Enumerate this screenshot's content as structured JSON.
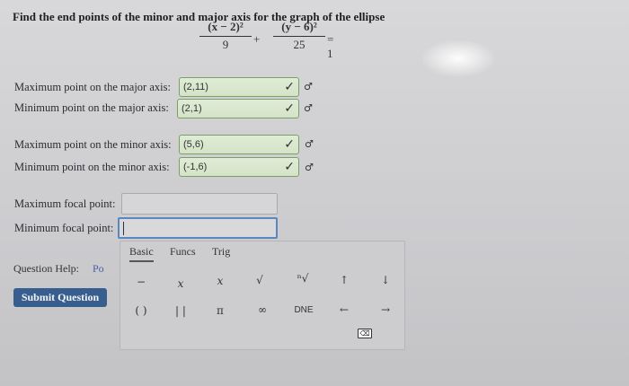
{
  "question": "Find the end points of the minor and major axis for the graph of the ellipse",
  "equation": {
    "num1": "(x − 2)²",
    "den1": "9",
    "plus": "+",
    "num2": "(y − 6)²",
    "den2": "25",
    "equals": "= 1"
  },
  "rows": [
    {
      "label": "Maximum point on the major axis:",
      "value": "(2,11)"
    },
    {
      "label": "Minimum point on the major axis:",
      "value": "(2,1)"
    },
    {
      "label": "Maximum point on the minor axis:",
      "value": "(5,6)"
    },
    {
      "label": "Minimum point on the minor axis:",
      "value": "(-1,6)"
    }
  ],
  "focal": {
    "max_label": "Maximum focal point:",
    "min_label": "Minimum focal point:",
    "max_value": "",
    "min_value": ""
  },
  "check_mark": "✓",
  "keyboard": {
    "tabs": [
      "Basic",
      "Funcs",
      "Trig"
    ],
    "row1": [
      "−",
      "x",
      "x",
      "√",
      "ⁿ√",
      "↑",
      "↓"
    ],
    "row2": [
      "( )",
      "| |",
      "π",
      "∞",
      "DNE",
      "←",
      "→"
    ],
    "backspace": "⌫"
  },
  "question_help": {
    "label": "Question Help:",
    "link": "Po"
  },
  "submit_label": "Submit Question"
}
